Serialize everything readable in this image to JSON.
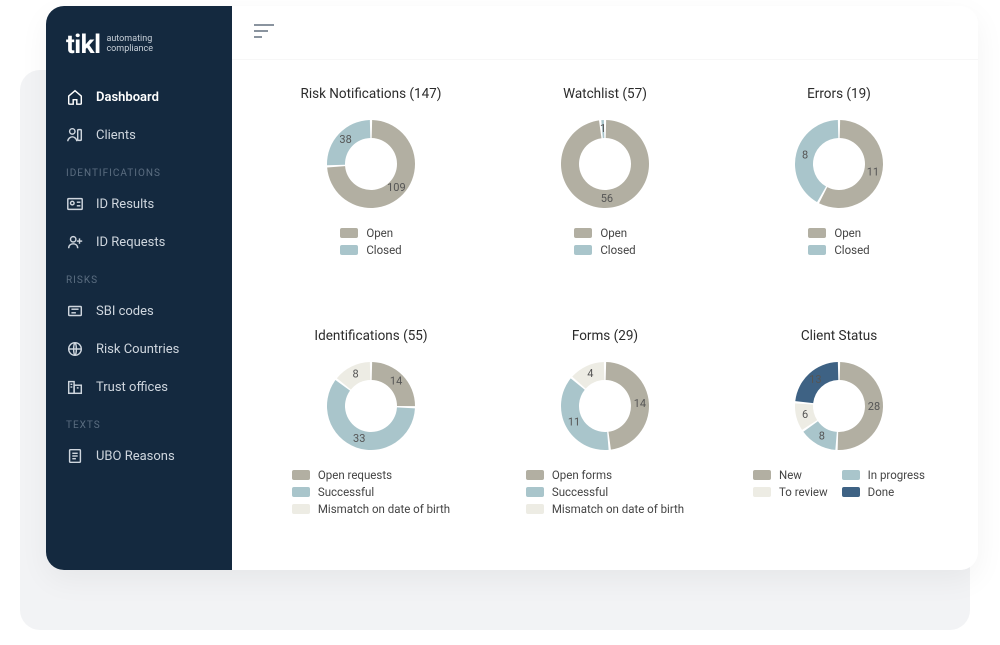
{
  "brand": {
    "name": "tikl",
    "tagline1": "automating",
    "tagline2": "compliance"
  },
  "colors": {
    "sidebar_bg": "#14293f",
    "grey": "#b2afa2",
    "teal": "#a9c5cb",
    "off": "#edece4",
    "blue": "#3e6284",
    "bluegrey": "#8ea0af"
  },
  "sidebar": {
    "items": [
      {
        "label": "Dashboard",
        "icon": "home",
        "active": true
      },
      {
        "label": "Clients",
        "icon": "user"
      }
    ],
    "groups": [
      {
        "label": "IDENTIFICATIONS",
        "items": [
          {
            "label": "ID Results",
            "icon": "id-card"
          },
          {
            "label": "ID Requests",
            "icon": "user-plus"
          }
        ]
      },
      {
        "label": "RISKS",
        "items": [
          {
            "label": "SBI codes",
            "icon": "tag"
          },
          {
            "label": "Risk Countries",
            "icon": "globe"
          },
          {
            "label": "Trust offices",
            "icon": "building"
          }
        ]
      },
      {
        "label": "TEXTS",
        "items": [
          {
            "label": "UBO Reasons",
            "icon": "document"
          }
        ]
      }
    ]
  },
  "chart_data": [
    {
      "type": "pie",
      "title": "Risk Notifications (147)",
      "series": [
        {
          "name": "Open",
          "value": 109,
          "color": "grey"
        },
        {
          "name": "Closed",
          "value": 38,
          "color": "teal"
        }
      ]
    },
    {
      "type": "pie",
      "title": "Watchlist (57)",
      "series": [
        {
          "name": "Open",
          "value": 56,
          "color": "grey"
        },
        {
          "name": "Closed",
          "value": 1,
          "color": "teal"
        }
      ]
    },
    {
      "type": "pie",
      "title": "Errors (19)",
      "series": [
        {
          "name": "Open",
          "value": 11,
          "color": "grey"
        },
        {
          "name": "Closed",
          "value": 8,
          "color": "teal"
        }
      ]
    },
    {
      "type": "pie",
      "title": "Identifications (55)",
      "series": [
        {
          "name": "Open requests",
          "value": 14,
          "color": "grey"
        },
        {
          "name": "Successful",
          "value": 33,
          "color": "teal"
        },
        {
          "name": "Mismatch on date of birth",
          "value": 8,
          "color": "off"
        }
      ]
    },
    {
      "type": "pie",
      "title": "Forms (29)",
      "series": [
        {
          "name": "Open forms",
          "value": 14,
          "color": "grey"
        },
        {
          "name": "Successful",
          "value": 11,
          "color": "teal"
        },
        {
          "name": "Mismatch on date of birth",
          "value": 4,
          "color": "off"
        }
      ]
    },
    {
      "type": "pie",
      "title": "Client Status",
      "series": [
        {
          "name": "New",
          "value": 28,
          "color": "grey"
        },
        {
          "name": "In progress",
          "value": 8,
          "color": "teal"
        },
        {
          "name": "To review",
          "value": 6,
          "color": "off"
        },
        {
          "name": "Done",
          "value": 13,
          "color": "blue"
        }
      ],
      "legend_grid": true
    }
  ]
}
